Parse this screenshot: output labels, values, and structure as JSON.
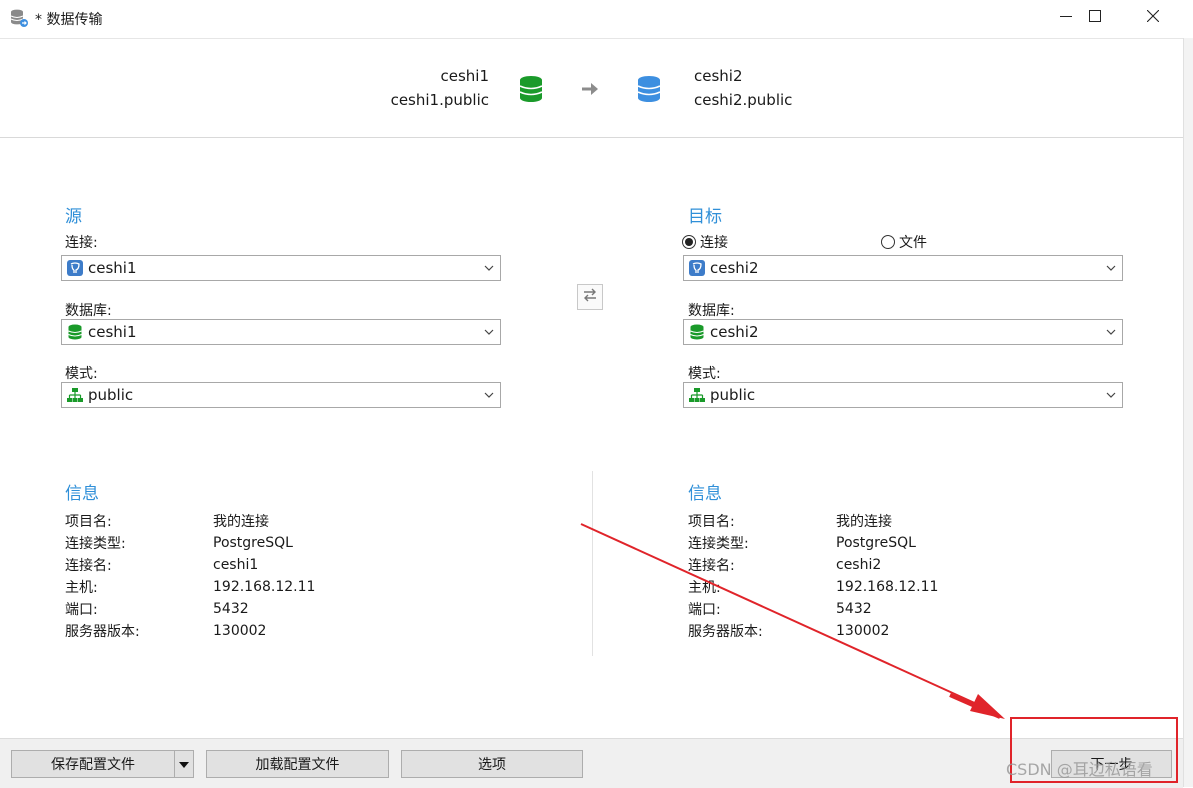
{
  "window": {
    "title": "* 数据传输",
    "controls": {
      "minimize_icon": "minimize-icon",
      "maximize_icon": "maximize-icon",
      "close_icon": "close-icon"
    }
  },
  "banner": {
    "source_connection": "ceshi1",
    "source_schema": "ceshi1.public",
    "target_connection": "ceshi2",
    "target_schema": "ceshi2.public",
    "source_db_color": "#1a9a2a",
    "target_db_color": "#3d8fe0"
  },
  "source": {
    "title": "源",
    "connection_label": "连接:",
    "connection_value": "ceshi1",
    "database_label": "数据库:",
    "database_value": "ceshi1",
    "schema_label": "模式:",
    "schema_value": "public"
  },
  "target": {
    "title": "目标",
    "radio_connection": "连接",
    "radio_file": "文件",
    "selected_radio": "连接",
    "connection_value": "ceshi2",
    "database_label": "数据库:",
    "database_value": "ceshi2",
    "schema_label": "模式:",
    "schema_value": "public"
  },
  "source_info": {
    "title": "信息",
    "rows": [
      {
        "key": "项目名:",
        "value": "我的连接"
      },
      {
        "key": "连接类型:",
        "value": "PostgreSQL"
      },
      {
        "key": "连接名:",
        "value": "ceshi1"
      },
      {
        "key": "主机:",
        "value": "192.168.12.11"
      },
      {
        "key": "端口:",
        "value": "5432"
      },
      {
        "key": "服务器版本:",
        "value": "130002"
      }
    ]
  },
  "target_info": {
    "title": "信息",
    "rows": [
      {
        "key": "项目名:",
        "value": "我的连接"
      },
      {
        "key": "连接类型:",
        "value": "PostgreSQL"
      },
      {
        "key": "连接名:",
        "value": "ceshi2"
      },
      {
        "key": "主机:",
        "value": "192.168.12.11"
      },
      {
        "key": "端口:",
        "value": "5432"
      },
      {
        "key": "服务器版本:",
        "value": "130002"
      }
    ]
  },
  "buttons": {
    "save_config": "保存配置文件",
    "load_config": "加载配置文件",
    "options": "选项",
    "next": "下一步"
  },
  "watermark": "CSDN @耳边私语看",
  "colors": {
    "accent": "#2f8fd8",
    "annotation": "#e0242a"
  }
}
